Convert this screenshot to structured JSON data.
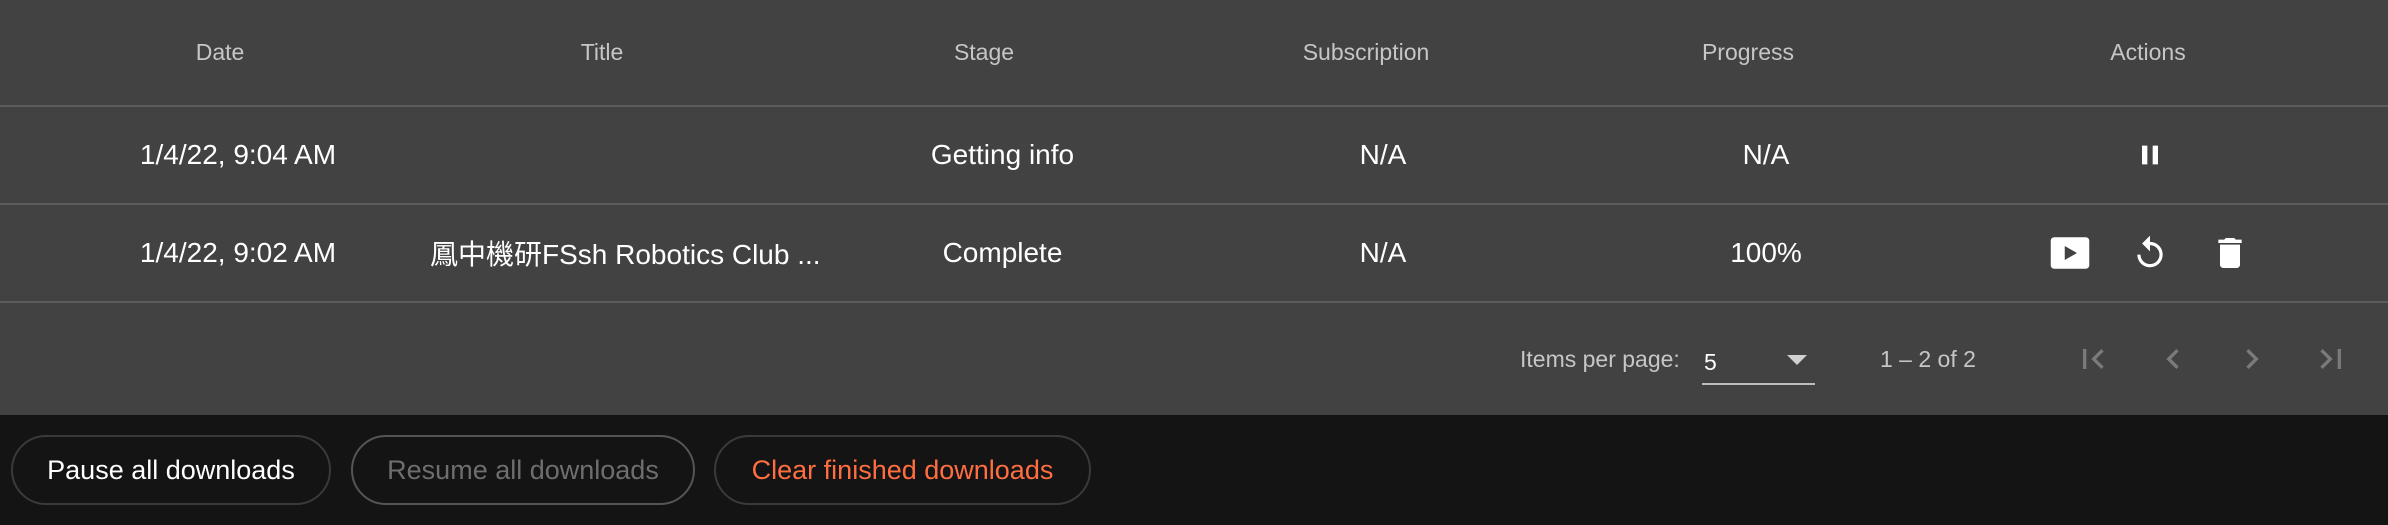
{
  "table": {
    "headers": {
      "date": "Date",
      "title": "Title",
      "stage": "Stage",
      "subscription": "Subscription",
      "progress": "Progress",
      "actions": "Actions"
    },
    "rows": [
      {
        "date": "1/4/22, 9:04 AM",
        "title": "",
        "stage": "Getting info",
        "subscription": "N/A",
        "progress": "N/A",
        "actions": [
          "pause-icon"
        ]
      },
      {
        "date": "1/4/22, 9:02 AM",
        "title": "鳳中機研FSsh Robotics Club ...",
        "stage": "Complete",
        "subscription": "N/A",
        "progress": "100%",
        "actions": [
          "play-icon",
          "restart-icon",
          "delete-icon"
        ]
      }
    ]
  },
  "paginator": {
    "items_per_page_label": "Items per page:",
    "items_per_page_value": "5",
    "range_label": "1 – 2 of 2",
    "icons": [
      "first-page-icon",
      "previous-page-icon",
      "next-page-icon",
      "last-page-icon"
    ]
  },
  "bottom_actions": {
    "pause_all": "Pause all downloads",
    "resume_all": "Resume all downloads",
    "clear_finished": "Clear finished downloads"
  },
  "colors": {
    "card_background": "#424242",
    "page_background": "#141414",
    "accent_warn": "#ff6e40",
    "divider": "#5c5c5c"
  }
}
